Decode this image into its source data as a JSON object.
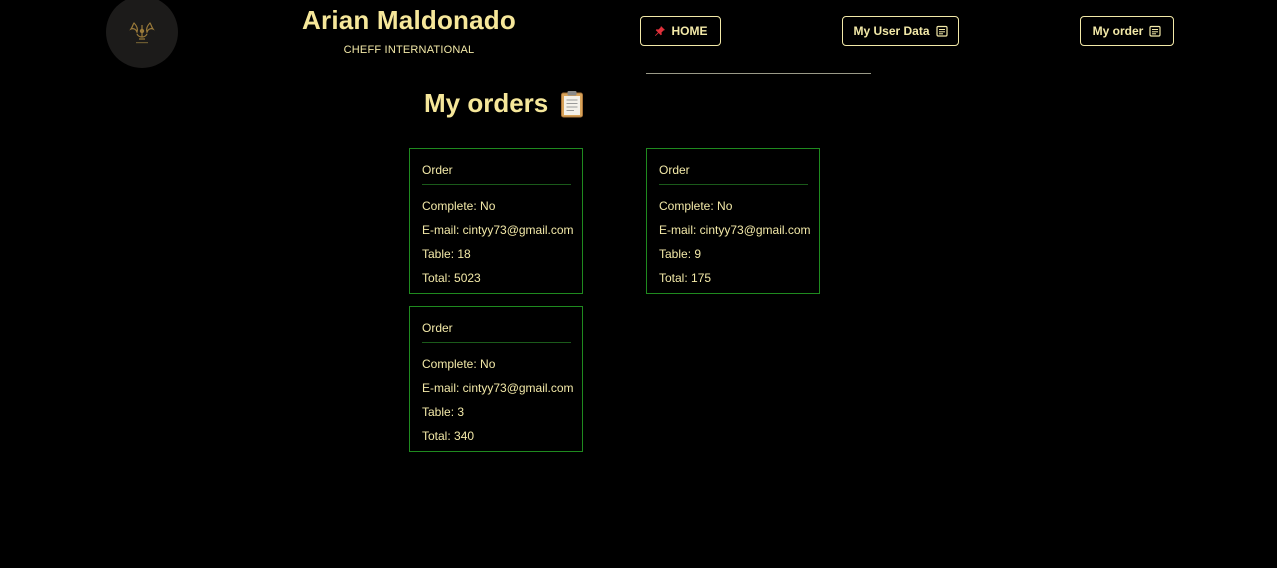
{
  "header": {
    "logo_icon": "chef-crest-icon",
    "title": "Arian Maldonado",
    "subtitle": "CHEFF INTERNATIONAL"
  },
  "nav": {
    "home_label": "HOME",
    "home_icon": "pushpin-icon",
    "user_data_label": "My User Data",
    "user_data_icon": "calendar-icon",
    "order_label": "My order",
    "order_icon": "calendar-icon"
  },
  "main": {
    "title": "My orders",
    "title_icon": "clipboard-icon"
  },
  "orders": [
    {
      "heading": "Order",
      "complete": "Complete: No",
      "email": "E-mail: cintyy73@gmail.com",
      "table": "Table: 18",
      "total": "Total: 5023"
    },
    {
      "heading": "Order",
      "complete": "Complete: No",
      "email": "E-mail: cintyy73@gmail.com",
      "table": "Table: 9",
      "total": "Total: 175"
    },
    {
      "heading": "Order",
      "complete": "Complete: No",
      "email": "E-mail: cintyy73@gmail.com",
      "table": "Table: 3",
      "total": "Total: 340"
    }
  ],
  "colors": {
    "background": "#000000",
    "accent_text": "#f6e79a",
    "card_border": "#1f8a1f",
    "home_pin": "#e0303a"
  }
}
